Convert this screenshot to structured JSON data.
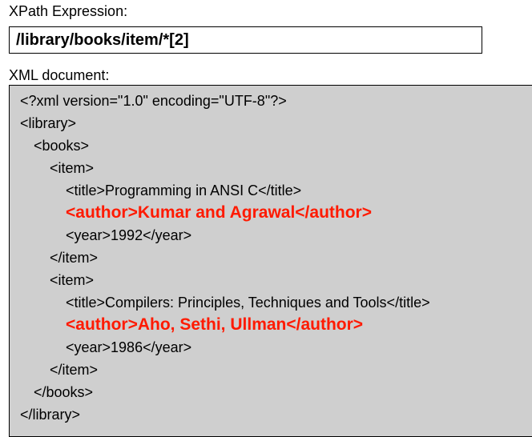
{
  "xpath": {
    "label": "XPath Expression:",
    "value_plain": "/library/books/item/*",
    "value_bracket": "[2]"
  },
  "xml": {
    "label": "XML document:",
    "lines": [
      "<?xml version=\"1.0\" encoding=\"UTF-8\"?>",
      "<library>",
      "<books>",
      "<item>",
      "<title>Programming in ANSI C</title>",
      "<author>Kumar and Agrawal</author>",
      "<year>1992</year>",
      "</item>",
      "<item>",
      "<title>Compilers: Principles, Techniques and Tools</title>",
      "<author>Aho, Sethi, Ullman</author>",
      "<year>1986</year>",
      "</item>",
      "</books>",
      "</library>"
    ]
  },
  "colors": {
    "panel_background": "#cfcfcf",
    "highlight": "#ff1a00"
  }
}
